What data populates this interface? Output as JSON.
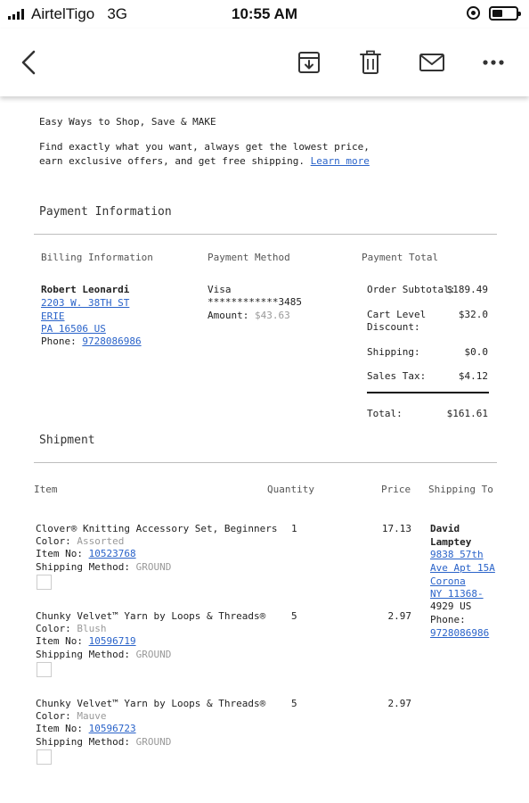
{
  "status_bar": {
    "carrier": "AirtelTigo",
    "network": "3G",
    "time": "10:55 AM",
    "battery_level": 0.45
  },
  "toolbar": {
    "back_icon": "chevron-left-icon",
    "archive_icon": "archive-icon",
    "delete_icon": "trash-icon",
    "mail_icon": "envelope-icon",
    "more_icon": "more-horizontal-icon"
  },
  "promo": {
    "heading": "Easy Ways to Shop, Save & MAKE",
    "line1": "Find exactly what you want, always get the lowest price,",
    "line2": "earn exclusive offers, and get free shipping.",
    "learn_more": "Learn more"
  },
  "payment": {
    "title": "Payment Information",
    "billing_head": "Billing Information",
    "method_head": "Payment Method",
    "total_head": "Payment Total",
    "billing": {
      "name": "Robert Leonardi",
      "street": "2203 W. 38TH ST",
      "city": "ERIE",
      "state_zip": "PA 16506 US",
      "phone_label": "Phone:",
      "phone": "9728086986"
    },
    "method": {
      "card": "Visa",
      "number": "************3485",
      "amount_label": "Amount:",
      "amount": "$43.63"
    },
    "totals": {
      "subtotal_label": "Order Subtotal:",
      "subtotal": "$189.49",
      "discount_label_1": "Cart Level",
      "discount_label_2": "Discount:",
      "discount": "$32.0",
      "shipping_label": "Shipping:",
      "shipping": "$0.0",
      "tax_label": "Sales Tax:",
      "tax": "$4.12",
      "total_label": "Total:",
      "total": "$161.61"
    }
  },
  "shipment": {
    "title": "Shipment",
    "headers": {
      "item": "Item",
      "quantity": "Quantity",
      "price": "Price",
      "shipping_to": "Shipping To"
    },
    "items": [
      {
        "name": "Clover® Knitting Accessory Set, Beginners",
        "color_label": "Color:",
        "color": "Assorted",
        "item_no_label": "Item No:",
        "item_no": "10523768",
        "method_label": "Shipping Method:",
        "method": "GROUND",
        "quantity": "1",
        "price": "17.13"
      },
      {
        "name": "Chunky Velvet™ Yarn by Loops & Threads®",
        "color_label": "Color:",
        "color": "Blush",
        "item_no_label": "Item No:",
        "item_no": "10596719",
        "method_label": "Shipping Method:",
        "method": "GROUND",
        "quantity": "5",
        "price": "2.97"
      },
      {
        "name": "Chunky Velvet™ Yarn by Loops & Threads®",
        "color_label": "Color:",
        "color": "Mauve",
        "item_no_label": "Item No:",
        "item_no": "10596723",
        "method_label": "Shipping Method:",
        "method": "GROUND",
        "quantity": "5",
        "price": "2.97"
      }
    ],
    "ship_to": {
      "first_name": "David",
      "last_name": "Lamptey",
      "street_1": "9838 57th",
      "street_2": "Ave Apt 15A",
      "city": "Corona",
      "state_zip": "NY 11368-",
      "zip_ext": "4929 US",
      "phone_label": "Phone:",
      "phone": "9728086986"
    }
  },
  "colors": {
    "link": "#2a63c9",
    "text": "#222222",
    "muted": "#999999",
    "divider": "#bdbdbd"
  }
}
